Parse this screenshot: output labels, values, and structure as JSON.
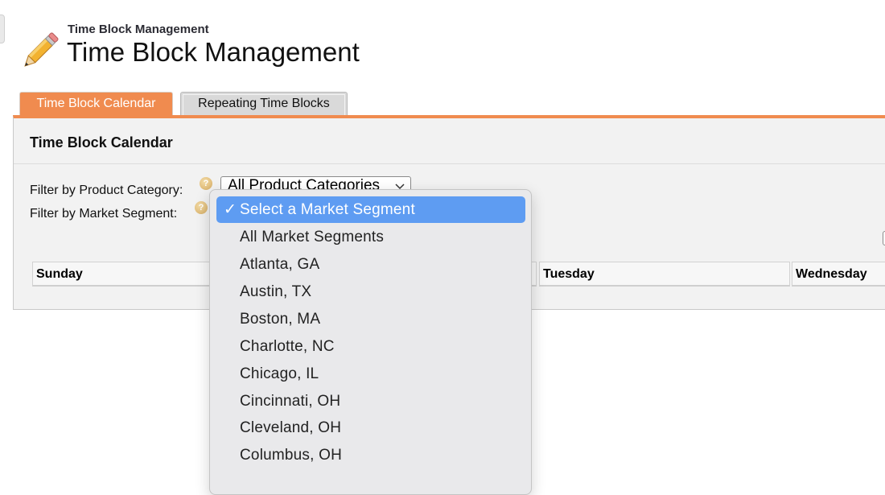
{
  "header": {
    "subtitle": "Time Block Management",
    "title": "Time Block Management",
    "icon": "pencil-icon"
  },
  "tabs": [
    {
      "label": "Time Block Calendar",
      "active": true
    },
    {
      "label": "Repeating Time Blocks",
      "active": false
    }
  ],
  "panel": {
    "title": "Time Block Calendar",
    "filters": {
      "product_category_label": "Filter by Product Category:",
      "product_category_value": "All Product Categories",
      "market_segment_label": "Filter by Market Segment:"
    },
    "days": [
      "Sunday",
      "Tuesday",
      "Wednesday"
    ]
  },
  "market_segment_dropdown": {
    "check": "✓",
    "selected_index": 0,
    "options": [
      "Select a Market Segment",
      "All Market Segments",
      "Atlanta, GA",
      "Austin, TX",
      "Boston, MA",
      "Charlotte, NC",
      "Chicago, IL",
      "Cincinnati, OH",
      "Cleveland, OH",
      "Columbus, OH"
    ]
  },
  "colors": {
    "accent": "#f08b4f",
    "selected_option": "#5e9cf2",
    "panel_bg": "#f2f2f2"
  }
}
